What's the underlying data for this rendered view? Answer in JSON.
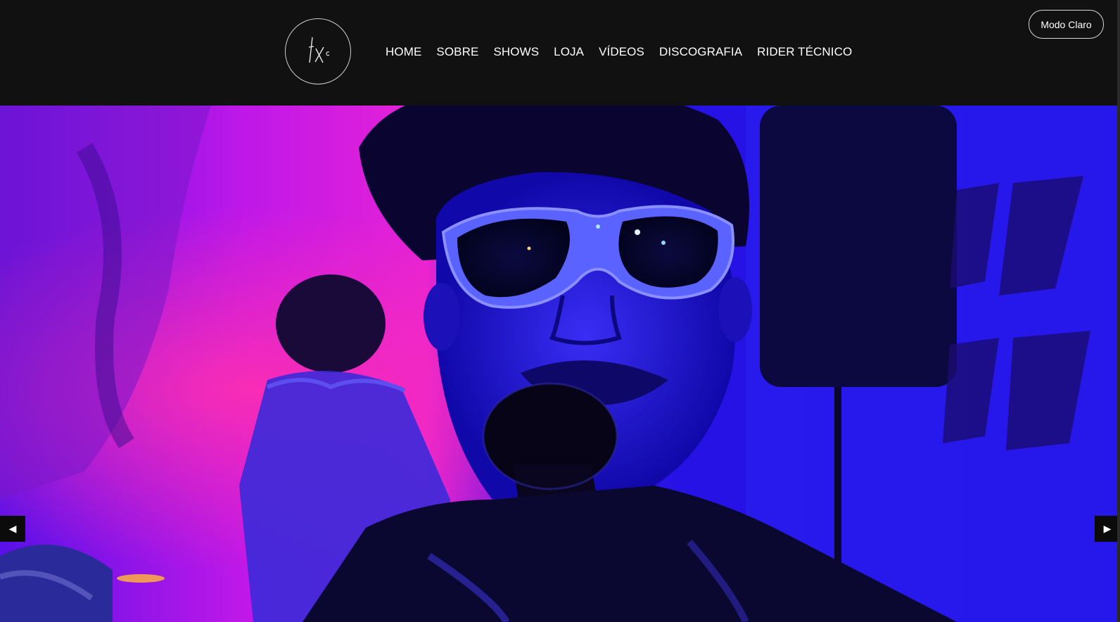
{
  "header": {
    "logo_icon": "fx-monogram-logo-icon",
    "nav": [
      {
        "label": "HOME"
      },
      {
        "label": "SOBRE"
      },
      {
        "label": "SHOWS"
      },
      {
        "label": "LOJA"
      },
      {
        "label": "VÍDEOS"
      },
      {
        "label": "DISCOGRAFIA"
      },
      {
        "label": "RIDER TÉCNICO"
      }
    ],
    "mode_toggle_label": "Modo Claro"
  },
  "carousel": {
    "prev_icon": "◀",
    "next_icon": "▶"
  },
  "colors": {
    "header_bg": "#111111",
    "nav_text": "#ffffff",
    "hero_blue": "#1d0bd8",
    "hero_magenta": "#d21bdc"
  }
}
